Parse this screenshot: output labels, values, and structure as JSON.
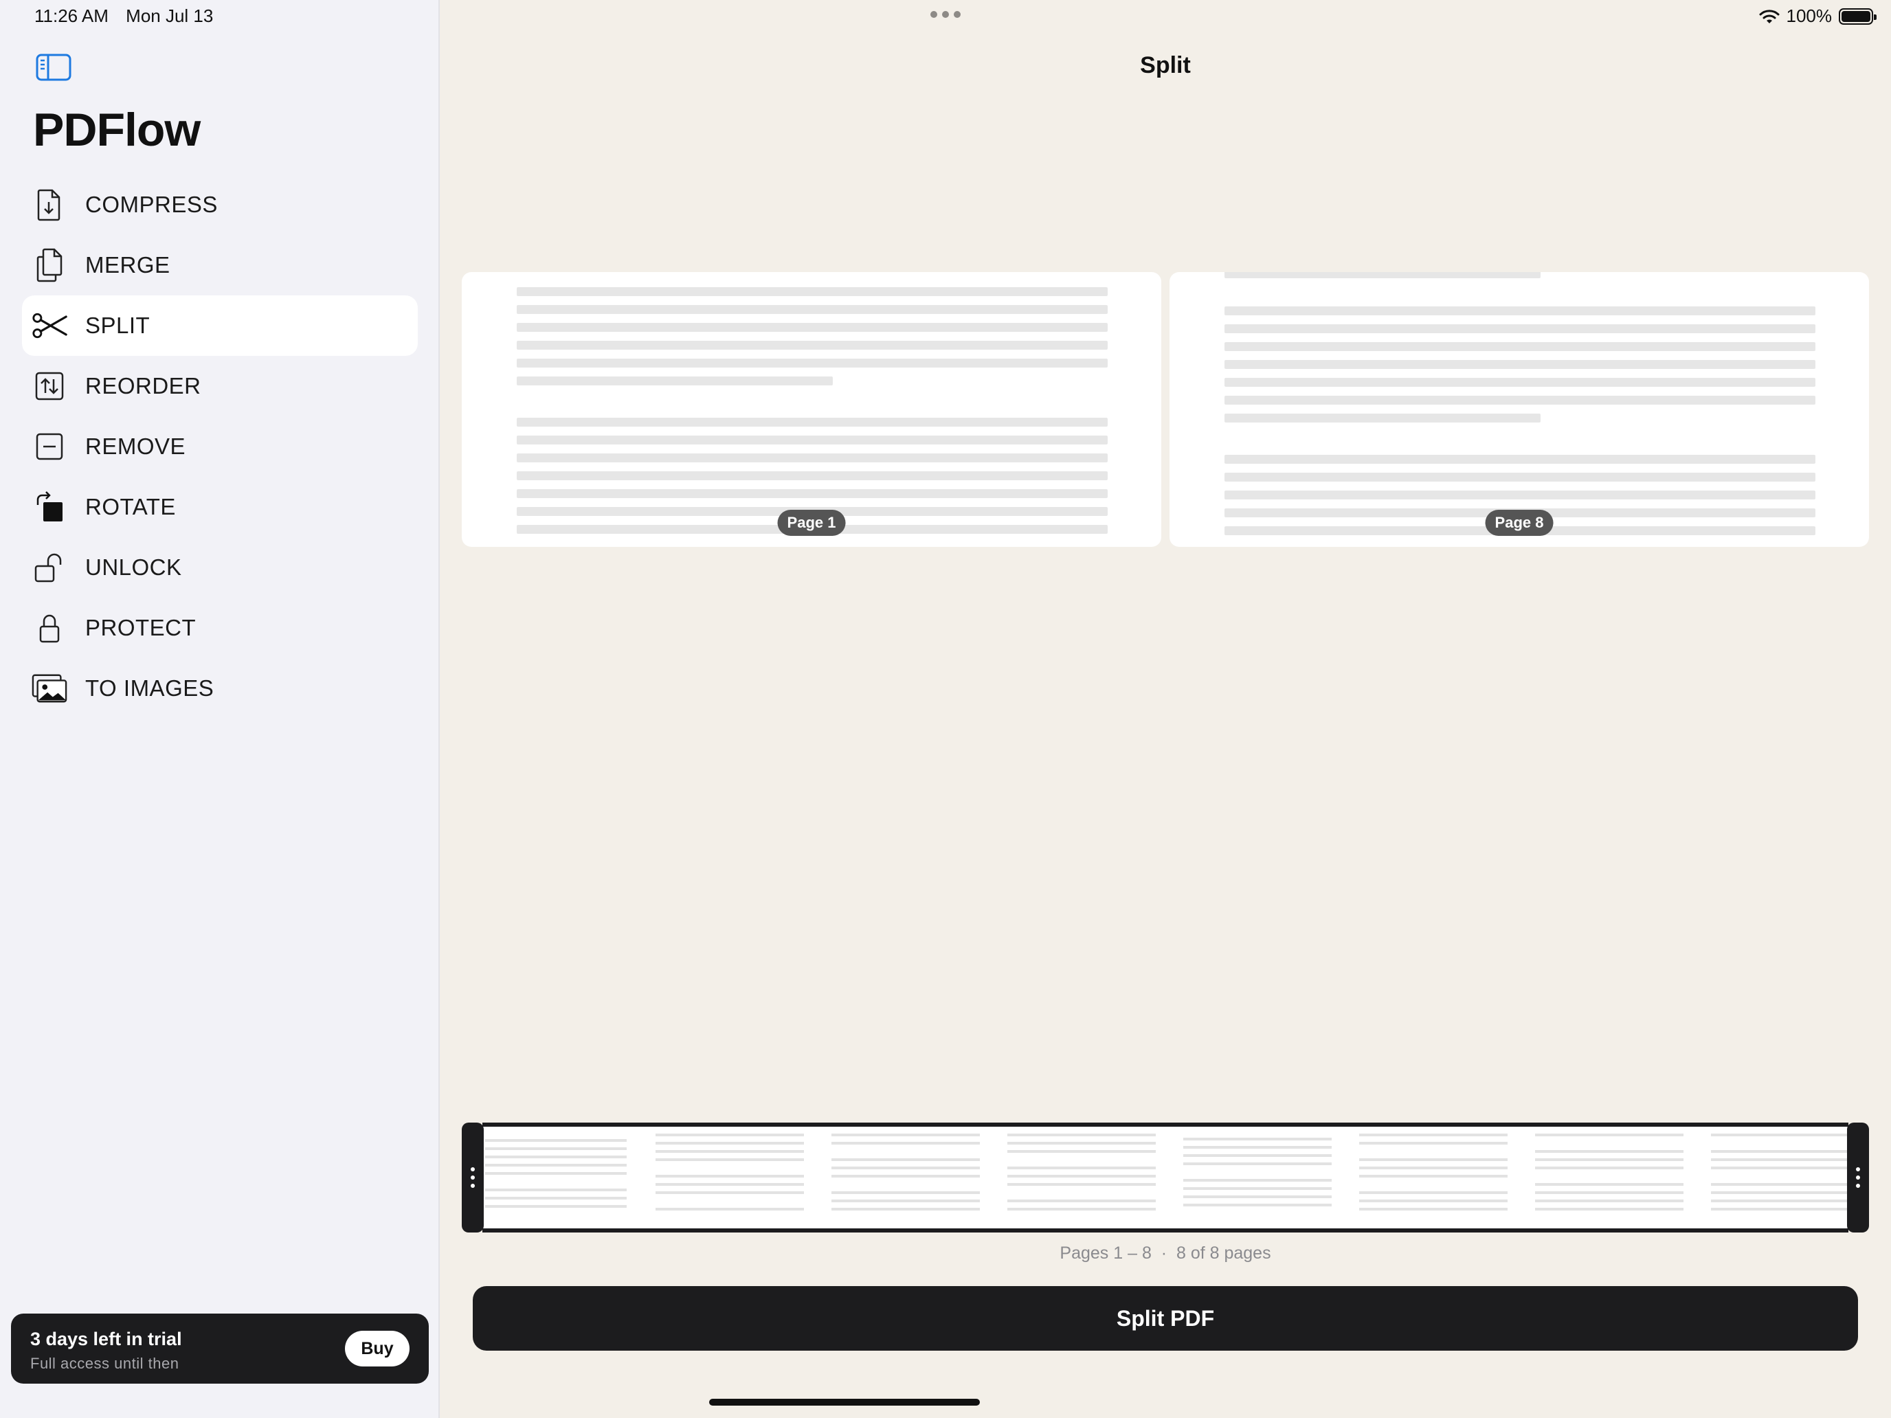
{
  "status_bar": {
    "time": "11:26 AM",
    "date": "Mon Jul 13",
    "battery": "100%"
  },
  "sidebar": {
    "app_title": "PDFlow",
    "items": [
      {
        "label": "COMPRESS",
        "icon": "compress-doc-icon"
      },
      {
        "label": "MERGE",
        "icon": "merge-docs-icon"
      },
      {
        "label": "SPLIT",
        "icon": "scissors-icon",
        "active": true
      },
      {
        "label": "REORDER",
        "icon": "reorder-icon"
      },
      {
        "label": "REMOVE",
        "icon": "remove-icon"
      },
      {
        "label": "ROTATE",
        "icon": "rotate-icon"
      },
      {
        "label": "UNLOCK",
        "icon": "unlock-icon"
      },
      {
        "label": "PROTECT",
        "icon": "lock-icon"
      },
      {
        "label": "TO IMAGES",
        "icon": "images-icon"
      }
    ],
    "trial": {
      "title": "3 days left in trial",
      "subtitle": "Full access until then",
      "buy_label": "Buy"
    }
  },
  "main": {
    "title": "Split",
    "previews": [
      {
        "label": "Page 1"
      },
      {
        "label": "Page 8"
      }
    ],
    "range_text": "Pages 1 – 8  ·  8 of 8 pages",
    "split_button": "Split PDF"
  },
  "colors": {
    "background": "#f3efe8",
    "sidebar": "#f2f2f7",
    "dark": "#1c1c1e",
    "accent": "#1e7ae0"
  }
}
